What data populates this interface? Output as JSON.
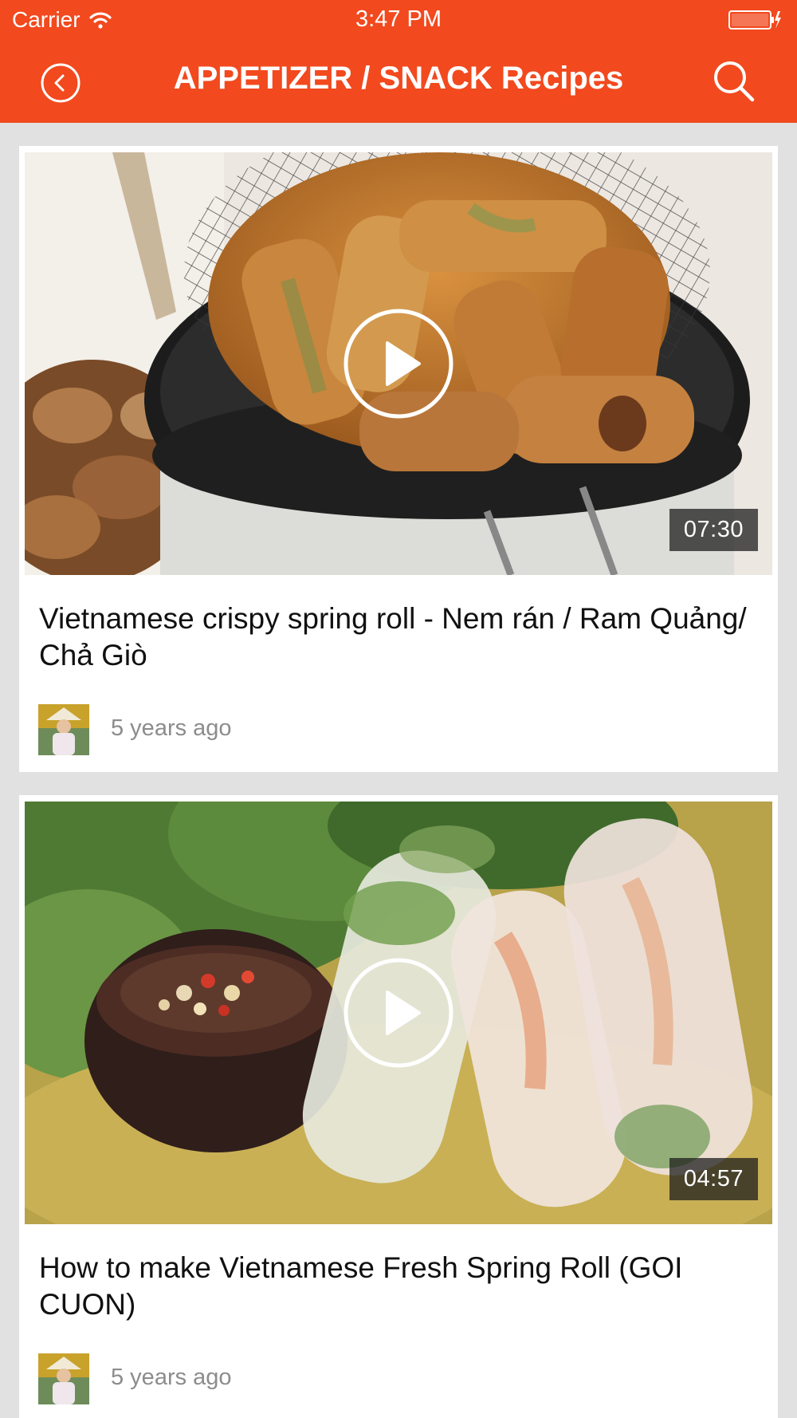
{
  "status_bar": {
    "carrier": "Carrier",
    "time": "3:47 PM"
  },
  "nav": {
    "title": "APPETIZER / SNACK Recipes",
    "back_icon": "back-circle-icon",
    "search_icon": "search-icon"
  },
  "colors": {
    "accent": "#f2491e",
    "background": "#e1e1e1",
    "card": "#ffffff",
    "muted_text": "#8c8c8c"
  },
  "videos": [
    {
      "title": "Vietnamese crispy spring roll - Nem rán / Ram Quảng/ Chả Giò",
      "duration": "07:30",
      "posted": "5 years ago"
    },
    {
      "title": "How to make Vietnamese Fresh Spring Roll (GOI CUON)",
      "duration": "04:57",
      "posted": "5 years ago"
    }
  ]
}
